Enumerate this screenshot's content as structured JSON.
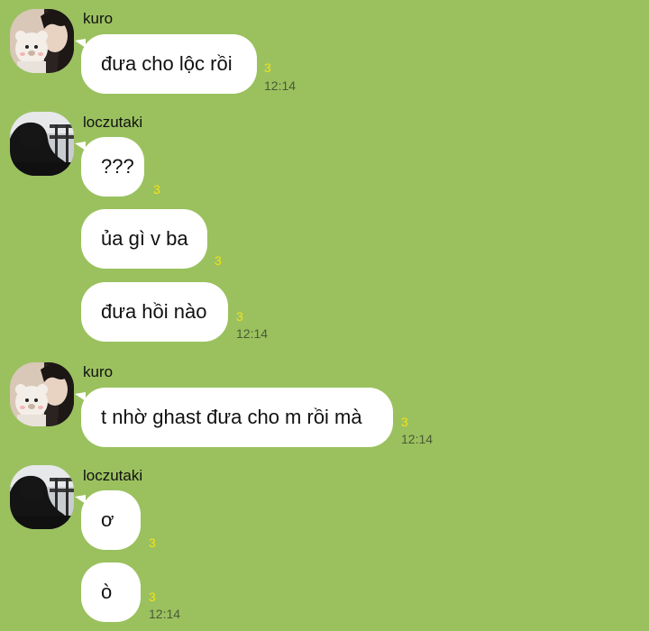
{
  "messages": {
    "kuro_1": {
      "sender": "kuro",
      "text": "đưa cho lộc rồi",
      "read": "3",
      "time": "12:14"
    },
    "loc_1": {
      "sender": "loczutaki",
      "text": "???",
      "read": "3"
    },
    "loc_2": {
      "text": "ủa gì v ba",
      "read": "3"
    },
    "loc_3": {
      "text": "đưa hồi nào",
      "read": "3",
      "time": "12:14"
    },
    "kuro_2": {
      "sender": "kuro",
      "text": "t nhờ ghast đưa cho m rồi mà",
      "read": "3",
      "time": "12:14"
    },
    "loc_4": {
      "sender": "loczutaki",
      "text": "ơ",
      "read": "3"
    },
    "loc_5": {
      "text": "ò",
      "read": "3",
      "time": "12:14"
    }
  },
  "colors": {
    "background": "#9bc15f",
    "bubble": "#ffffff",
    "read_count": "#f2e218",
    "timestamp": "#4a5a36"
  },
  "avatars": {
    "kuro": "avatar-kuro-plush-icon",
    "loczutaki": "avatar-loczutaki-silhouette-icon"
  }
}
